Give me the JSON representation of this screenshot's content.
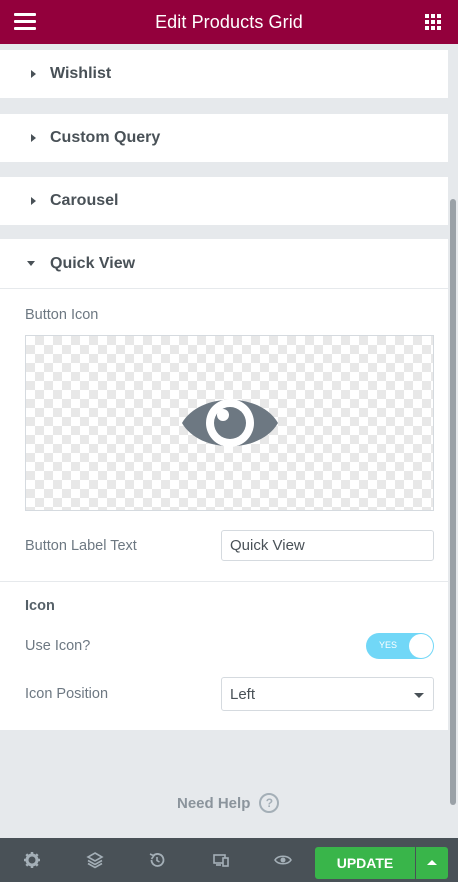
{
  "header": {
    "title": "Edit Products Grid"
  },
  "sections": [
    {
      "label": "Wishlist",
      "expanded": false
    },
    {
      "label": "Custom Query",
      "expanded": false
    },
    {
      "label": "Carousel",
      "expanded": false
    },
    {
      "label": "Quick View",
      "expanded": true
    }
  ],
  "quick_view": {
    "button_icon_label": "Button Icon",
    "button_label_text_label": "Button Label Text",
    "button_label_text_value": "Quick View",
    "icon_heading": "Icon",
    "use_icon_label": "Use Icon?",
    "use_icon_toggle": "YES",
    "icon_position_label": "Icon Position",
    "icon_position_value": "Left"
  },
  "need_help": "Need Help",
  "footer": {
    "update_label": "UPDATE"
  },
  "icons": [
    "menu-icon",
    "apps-grid-icon",
    "eye-icon",
    "help-icon",
    "settings-icon",
    "layers-icon",
    "history-icon",
    "responsive-icon",
    "preview-icon"
  ],
  "colors": {
    "header": "#93003c",
    "update": "#39b54a",
    "toggle": "#71d7f7",
    "footer": "#495157"
  }
}
